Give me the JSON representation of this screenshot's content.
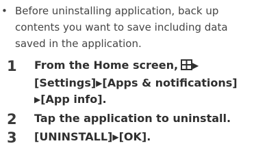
{
  "note": {
    "bullet": "•",
    "text": "Before uninstalling application, back up contents you want to save including data saved in the application."
  },
  "steps": [
    {
      "number": "1",
      "parts": {
        "a": "From the Home screen,",
        "arrow1": "▶",
        "b": "[Settings]",
        "arrow2": "▶",
        "c": "[Apps & notifications]",
        "arrow3": "▶",
        "d": "[App info]."
      },
      "icon": "apps-grid-icon"
    },
    {
      "number": "2",
      "text": "Tap the application to uninstall."
    },
    {
      "number": "3",
      "parts": {
        "a": "[UNINSTALL]",
        "arrow1": "▶",
        "b": "[OK]."
      }
    }
  ]
}
